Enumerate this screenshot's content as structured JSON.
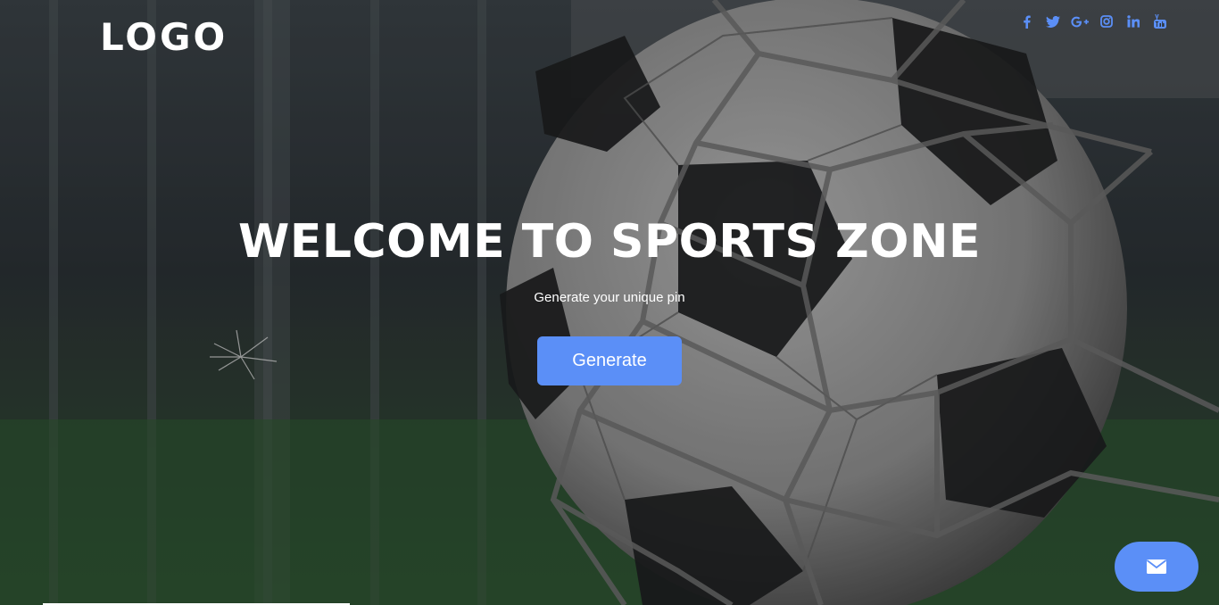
{
  "header": {
    "logo_text": "LOGO",
    "social_links": [
      {
        "name": "facebook-icon"
      },
      {
        "name": "twitter-icon"
      },
      {
        "name": "google-plus-icon"
      },
      {
        "name": "instagram-icon"
      },
      {
        "name": "linkedin-icon"
      },
      {
        "name": "youtube-icon"
      }
    ]
  },
  "hero": {
    "title": "WELCOME TO SPORTS ZONE",
    "subtitle": "Generate your unique pin",
    "button_label": "Generate"
  },
  "floating": {
    "icon": "envelope-icon"
  },
  "colors": {
    "accent": "#5b8ff7",
    "text": "#ffffff"
  }
}
